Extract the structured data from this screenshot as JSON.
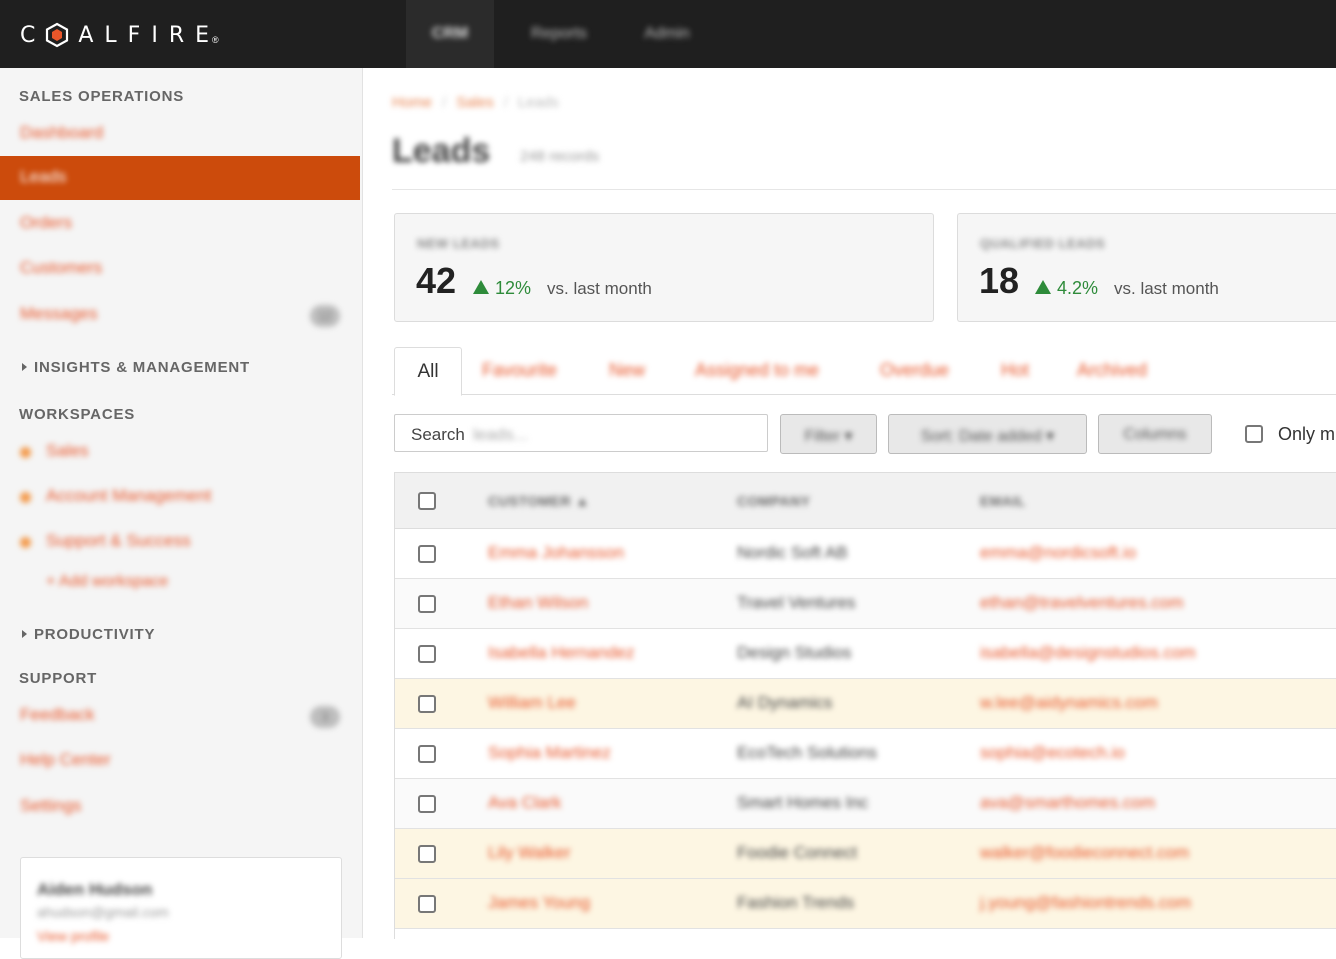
{
  "brand": {
    "letters_before": "C",
    "letters_after": "ALFIRE",
    "registered": "®",
    "accent": "#e8562a"
  },
  "top_nav": [
    {
      "label": "CRM",
      "active": true
    },
    {
      "label": "Reports",
      "active": false
    },
    {
      "label": "Admin",
      "active": false
    }
  ],
  "sidebar": {
    "sales_operations": {
      "heading": "SALES OPERATIONS",
      "items": [
        {
          "label": "Dashboard"
        },
        {
          "label": "Leads",
          "active": true
        },
        {
          "label": "Orders"
        },
        {
          "label": "Customers"
        },
        {
          "label": "Messages",
          "badge": "12"
        }
      ]
    },
    "insights_heading": "INSIGHTS & MANAGEMENT",
    "workspaces": {
      "heading": "WORKSPACES",
      "items": [
        {
          "label": "Sales"
        },
        {
          "label": "Account Management"
        },
        {
          "label": "Support & Success"
        }
      ],
      "add_label": "+ Add workspace"
    },
    "productivity_heading": "PRODUCTIVITY",
    "support": {
      "heading": "SUPPORT",
      "items": [
        {
          "label": "Feedback",
          "badge": "3"
        },
        {
          "label": "Help Center"
        },
        {
          "label": "Settings"
        }
      ]
    },
    "user": {
      "name": "Aiden Hudson",
      "email": "ahudson@gmail.com",
      "link": "View profile"
    }
  },
  "main": {
    "breadcrumb": [
      "Home",
      "Sales",
      "Leads"
    ],
    "title": "Leads",
    "subtitle": "248 records",
    "stats": [
      {
        "label": "NEW LEADS",
        "value": "42",
        "change": "12%",
        "compare": "vs. last month"
      },
      {
        "label": "QUALIFIED LEADS",
        "value": "18",
        "change": "4.2%",
        "compare": "vs. last month"
      }
    ],
    "tabs": [
      "All",
      "Favourite",
      "New",
      "Assigned to me",
      "Overdue",
      "Hot",
      "Archived"
    ],
    "search": {
      "label": "Search",
      "placeholder": "leads..."
    },
    "buttons": {
      "filter": "Filter ▾",
      "sort": "Sort: Date added ▾",
      "columns": "Columns"
    },
    "only_mine": "Only m",
    "table": {
      "columns": [
        "CUSTOMER ▲",
        "COMPANY",
        "EMAIL"
      ],
      "rows": [
        {
          "name": "Emma Johansson",
          "company": "Nordic Soft AB",
          "email": "emma@nordicsoft.io",
          "highlight": false
        },
        {
          "name": "Ethan Wilson",
          "company": "Travel Ventures",
          "email": "ethan@travelventures.com",
          "highlight": false
        },
        {
          "name": "Isabella Hernandez",
          "company": "Design Studios",
          "email": "isabella@designstudios.com",
          "highlight": false
        },
        {
          "name": "William Lee",
          "company": "AI Dynamics",
          "email": "w.lee@aidynamics.com",
          "highlight": true
        },
        {
          "name": "Sophia Martinez",
          "company": "EcoTech Solutions",
          "email": "sophia@ecotech.io",
          "highlight": false
        },
        {
          "name": "Ava Clark",
          "company": "Smart Homes Inc",
          "email": "ava@smarthomes.com",
          "highlight": false
        },
        {
          "name": "Lily Walker",
          "company": "Foodie Connect",
          "email": "walker@foodieconnect.com",
          "highlight": true
        },
        {
          "name": "James Young",
          "company": "Fashion Trends",
          "email": "j.young@fashiontrends.com",
          "highlight": true
        }
      ]
    }
  }
}
